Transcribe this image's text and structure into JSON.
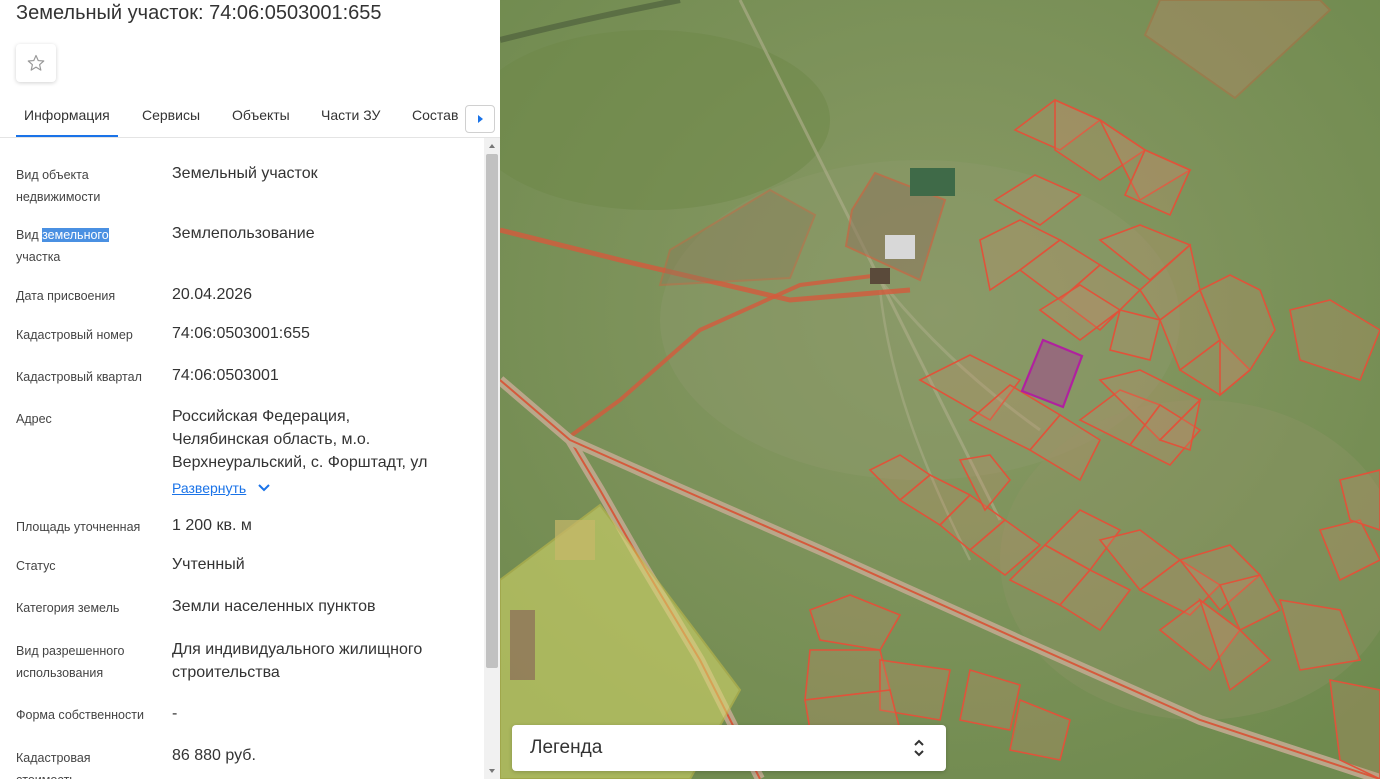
{
  "header": {
    "title": "Земельный участок: 74:06:0503001:655"
  },
  "tabs": [
    "Информация",
    "Сервисы",
    "Объекты",
    "Части ЗУ",
    "Состав"
  ],
  "info": {
    "object_type_label_1": "Вид объекта",
    "object_type_label_2": "недвижимости",
    "object_type_value": "Земельный участок",
    "plot_type_label_pre": "Вид ",
    "plot_type_label_hl": "земельного",
    "plot_type_label_2": "участка",
    "plot_type_value": "Землепользование",
    "date_label": "Дата присвоения",
    "date_value": "20.04.2026",
    "cadnum_label": "Кадастровый номер",
    "cadnum_value": "74:06:0503001:655",
    "quarter_label": "Кадастровый квартал",
    "quarter_value": "74:06:0503001",
    "address_label": "Адрес",
    "address_line_1": "Российская Федерация,",
    "address_line_2": "Челябинская область, м.о.",
    "address_line_3": "Верхнеуральский, с. Форштадт, ул",
    "expand_label": "Развернуть",
    "area_label": "Площадь уточненная",
    "area_value": "1 200 кв. м",
    "status_label": "Статус",
    "status_value": "Учтенный",
    "category_label": "Категория земель",
    "category_value": "Земли населенных пунктов",
    "permitted_label_1": "Вид разрешенного",
    "permitted_label_2": "использования",
    "permitted_value_1": "Для индивидуального жилищного",
    "permitted_value_2": "строительства",
    "ownership_label": "Форма собственности",
    "ownership_value": "-",
    "cost_label_1": "Кадастровая",
    "cost_label_2": "стоимость",
    "cost_value": "86 880 руб."
  },
  "legend": {
    "label": "Легенда"
  },
  "colors": {
    "accent": "#1a73e8",
    "parcel_outline": "#e0533a",
    "selected_parcel": "#b0219f"
  }
}
